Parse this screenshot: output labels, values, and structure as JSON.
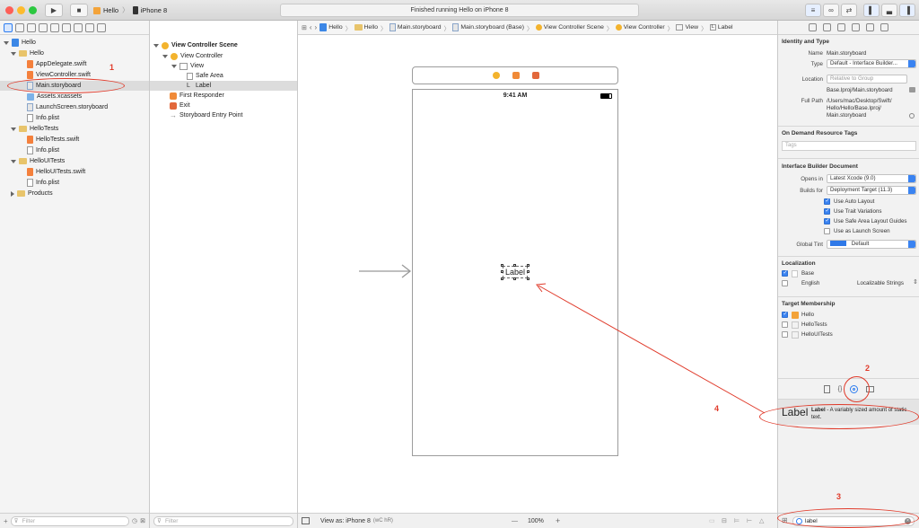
{
  "toolbar": {
    "scheme_target": "Hello",
    "scheme_device": "iPhone 8",
    "status": "Finished running Hello on iPhone 8"
  },
  "navigator": {
    "items": [
      {
        "label": "Hello",
        "kind": "project"
      },
      {
        "label": "Hello",
        "kind": "folder"
      },
      {
        "label": "AppDelegate.swift",
        "kind": "swift"
      },
      {
        "label": "ViewController.swift",
        "kind": "swift"
      },
      {
        "label": "Main.storyboard",
        "kind": "storyboard"
      },
      {
        "label": "Assets.xcassets",
        "kind": "assets"
      },
      {
        "label": "LaunchScreen.storyboard",
        "kind": "storyboard"
      },
      {
        "label": "Info.plist",
        "kind": "file"
      },
      {
        "label": "HelloTests",
        "kind": "folder"
      },
      {
        "label": "HelloTests.swift",
        "kind": "swift"
      },
      {
        "label": "Info.plist",
        "kind": "file"
      },
      {
        "label": "HelloUITests",
        "kind": "folder"
      },
      {
        "label": "HelloUITests.swift",
        "kind": "swift"
      },
      {
        "label": "Info.plist",
        "kind": "file"
      },
      {
        "label": "Products",
        "kind": "folder"
      }
    ],
    "filter_placeholder": "Filter"
  },
  "outline": {
    "items": [
      "View Controller Scene",
      "View Controller",
      "View",
      "Safe Area",
      "Label",
      "First Responder",
      "Exit",
      "Storyboard Entry Point"
    ],
    "filter_placeholder": "Filter"
  },
  "jumpbar": {
    "crumbs": [
      "Hello",
      "Hello",
      "Main.storyboard",
      "Main.storyboard (Base)",
      "View Controller Scene",
      "View Controller",
      "View",
      "Label"
    ]
  },
  "canvas": {
    "status_time": "9:41 AM",
    "label_text": "Label",
    "view_as": "View as: iPhone 8",
    "view_as_suffix": "(wC hR)",
    "zoom_minus": "—",
    "zoom": "100%",
    "zoom_plus": "+"
  },
  "inspector": {
    "identity_title": "Identity and Type",
    "name_label": "Name",
    "name_value": "Main.storyboard",
    "type_label": "Type",
    "type_value": "Default - Interface Builder...",
    "location_label": "Location",
    "location_value": "Relative to Group",
    "location_path": "Base.lproj/Main.storyboard",
    "fullpath_label": "Full Path",
    "fullpath_value": "/Users/mac/Desktop/Swift/Hello/Hello/Base.lproj/Main.storyboard",
    "fullpath_line1": "/Users/mac/Desktop/Swift/",
    "fullpath_line2": "Hello/Hello/Base.lproj/",
    "fullpath_line3": "Main.storyboard",
    "odr_title": "On Demand Resource Tags",
    "tags_placeholder": "Tags",
    "ibdoc_title": "Interface Builder Document",
    "opens_in_label": "Opens in",
    "opens_in_value": "Latest Xcode (9.0)",
    "builds_for_label": "Builds for",
    "builds_for_value": "Deployment Target (11.3)",
    "cb_auto_layout": "Use Auto Layout",
    "cb_trait": "Use Trait Variations",
    "cb_safe_area": "Use Safe Area Layout Guides",
    "cb_launch": "Use as Launch Screen",
    "global_tint_label": "Global Tint",
    "global_tint_value": "Default",
    "global_tint_color": "#2f79e8",
    "localization_title": "Localization",
    "loc_base": "Base",
    "loc_english": "English",
    "loc_english_value": "Localizable Strings",
    "membership_title": "Target Membership",
    "tm_hello": "Hello",
    "tm_tests": "HelloTests",
    "tm_uitests": "HelloUITests",
    "library_item_title": "Label",
    "library_item_name": "Label",
    "library_item_desc": " - A variably sized amount of static text.",
    "library_search": "label"
  },
  "annotations": {
    "n1": "1",
    "n2": "2",
    "n3": "3",
    "n4": "4",
    "color": "#e03a2a"
  }
}
